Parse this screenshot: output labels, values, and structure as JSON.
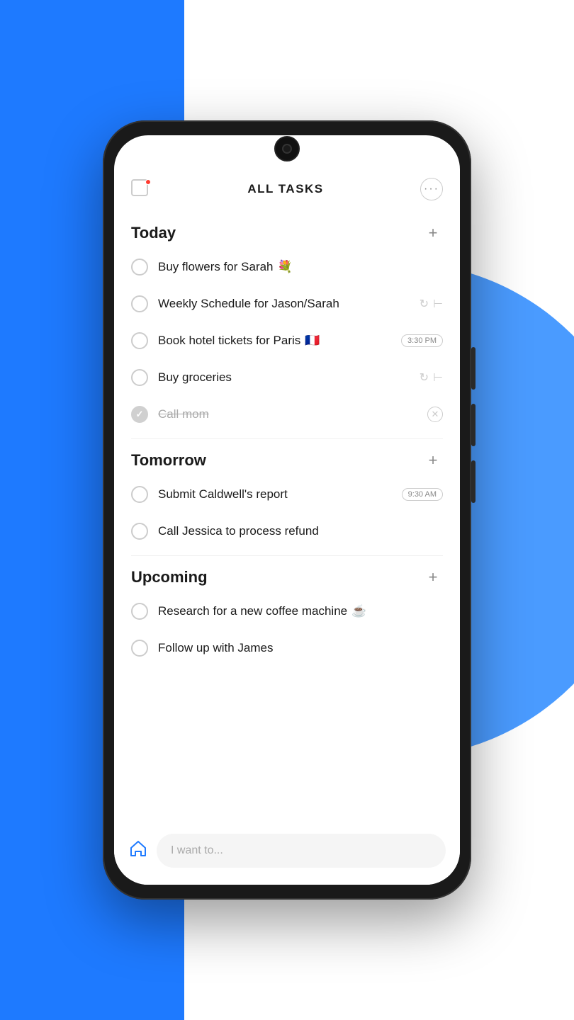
{
  "background": {
    "blue_color": "#1E7AFF",
    "circle_color": "#4A9BFF"
  },
  "header": {
    "title": "ALL TASKS",
    "more_icon": "•••"
  },
  "sections": [
    {
      "id": "today",
      "title": "Today",
      "tasks": [
        {
          "id": "t1",
          "text": "Buy flowers for Sarah",
          "emoji": "💐",
          "done": false,
          "badge": null,
          "has_repeat": false,
          "has_subtask": false
        },
        {
          "id": "t2",
          "text": "Weekly Schedule for Jason/Sarah",
          "emoji": null,
          "done": false,
          "badge": null,
          "has_repeat": true,
          "has_subtask": true
        },
        {
          "id": "t3",
          "text": "Book hotel tickets for Paris",
          "emoji": "🇫🇷",
          "done": false,
          "badge": "3:30 PM",
          "has_repeat": false,
          "has_subtask": false
        },
        {
          "id": "t4",
          "text": "Buy groceries",
          "emoji": null,
          "done": false,
          "badge": null,
          "has_repeat": true,
          "has_subtask": true
        },
        {
          "id": "t5",
          "text": "Call mom",
          "emoji": null,
          "done": true,
          "badge": null,
          "has_repeat": false,
          "has_subtask": false
        }
      ]
    },
    {
      "id": "tomorrow",
      "title": "Tomorrow",
      "tasks": [
        {
          "id": "tm1",
          "text": "Submit Caldwell's report",
          "emoji": null,
          "done": false,
          "badge": "9:30 AM",
          "has_repeat": false,
          "has_subtask": false
        },
        {
          "id": "tm2",
          "text": "Call Jessica to process refund",
          "emoji": null,
          "done": false,
          "badge": null,
          "has_repeat": false,
          "has_subtask": false
        }
      ]
    },
    {
      "id": "upcoming",
      "title": "Upcoming",
      "tasks": [
        {
          "id": "u1",
          "text": "Research for a new coffee machine",
          "emoji": "☕",
          "done": false,
          "badge": null,
          "has_repeat": false,
          "has_subtask": false
        },
        {
          "id": "u2",
          "text": "Follow up with James",
          "emoji": null,
          "done": false,
          "badge": null,
          "has_repeat": false,
          "has_subtask": false
        }
      ]
    }
  ],
  "bottom_bar": {
    "home_icon": "⌂",
    "input_placeholder": "I want to..."
  },
  "labels": {
    "add": "+",
    "section_titles": [
      "Today",
      "Tomorrow",
      "Upcoming"
    ]
  }
}
